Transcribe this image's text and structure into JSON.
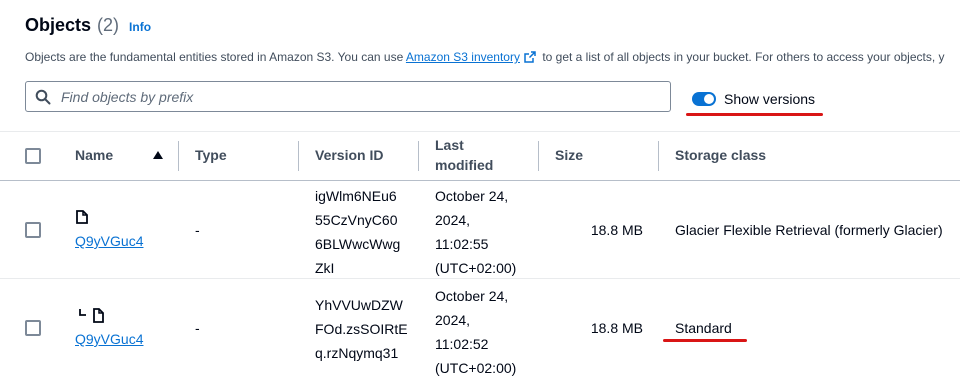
{
  "section": {
    "title": "Objects",
    "count": "(2)",
    "info_label": "Info",
    "description_prefix": "Objects are the fundamental entities stored in Amazon S3. You can use ",
    "inventory_link": "Amazon S3 inventory",
    "description_suffix": " to get a list of all objects in your bucket. For others to access your objects, y"
  },
  "search": {
    "placeholder": "Find objects by prefix",
    "value": ""
  },
  "show_versions": {
    "label": "Show versions",
    "checked": true
  },
  "table": {
    "headers": {
      "name": "Name",
      "type": "Type",
      "version_id": "Version ID",
      "last_modified_line1": "Last",
      "last_modified_line2": "modified",
      "size": "Size",
      "storage_class": "Storage class"
    },
    "rows": [
      {
        "icon": "file-icon",
        "name": "Q9yVGuc4",
        "type": "-",
        "version_id_lines": [
          "igWlm6NEu6",
          "55CzVnyC60",
          "6BLWwcWwg",
          "ZkI"
        ],
        "last_modified_lines": [
          "October 24,",
          "2024,",
          "11:02:55",
          "(UTC+02:00)"
        ],
        "size": "18.8 MB",
        "storage_class": "Glacier Flexible Retrieval (formerly Glacier)"
      },
      {
        "icon": "file-version-icon",
        "name": "Q9yVGuc4",
        "type": "-",
        "version_id_lines": [
          "YhVVUwDZW",
          "FOd.zsSOIRtE",
          "q.rzNqymq31"
        ],
        "last_modified_lines": [
          "October 24,",
          "2024,",
          "11:02:52",
          "(UTC+02:00)"
        ],
        "size": "18.8 MB",
        "storage_class": "Standard"
      }
    ]
  },
  "colors": {
    "link": "#0972d3",
    "toggle": "#0972d3",
    "annotation": "#d91515"
  }
}
